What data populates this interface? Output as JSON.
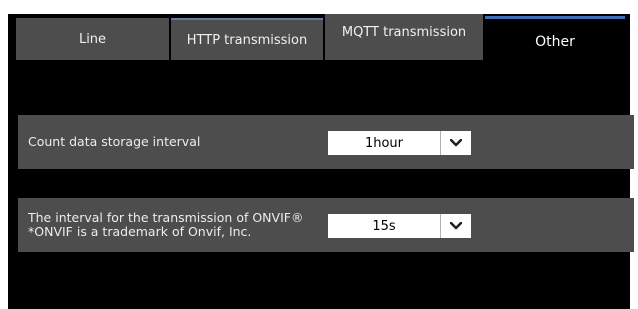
{
  "tabs": [
    {
      "label": "Line"
    },
    {
      "label": "HTTP transmission"
    },
    {
      "label": "MQTT transmission"
    },
    {
      "label": "Other",
      "selected": true
    }
  ],
  "settings": {
    "storage_interval": {
      "label": "Count data storage interval",
      "value": "1hour"
    },
    "onvif_interval": {
      "label": "The interval for the transmission of ONVIF®",
      "note": "*ONVIF is a trademark of Onvif, Inc.",
      "value": "15s"
    }
  },
  "icons": {
    "dropdown": "chevron-down-icon"
  },
  "colors": {
    "background": "#000000",
    "tab_bg": "#4d4d4d",
    "row_bg": "#4d4d4d",
    "active_tab_accent": "#3c6fb6"
  }
}
